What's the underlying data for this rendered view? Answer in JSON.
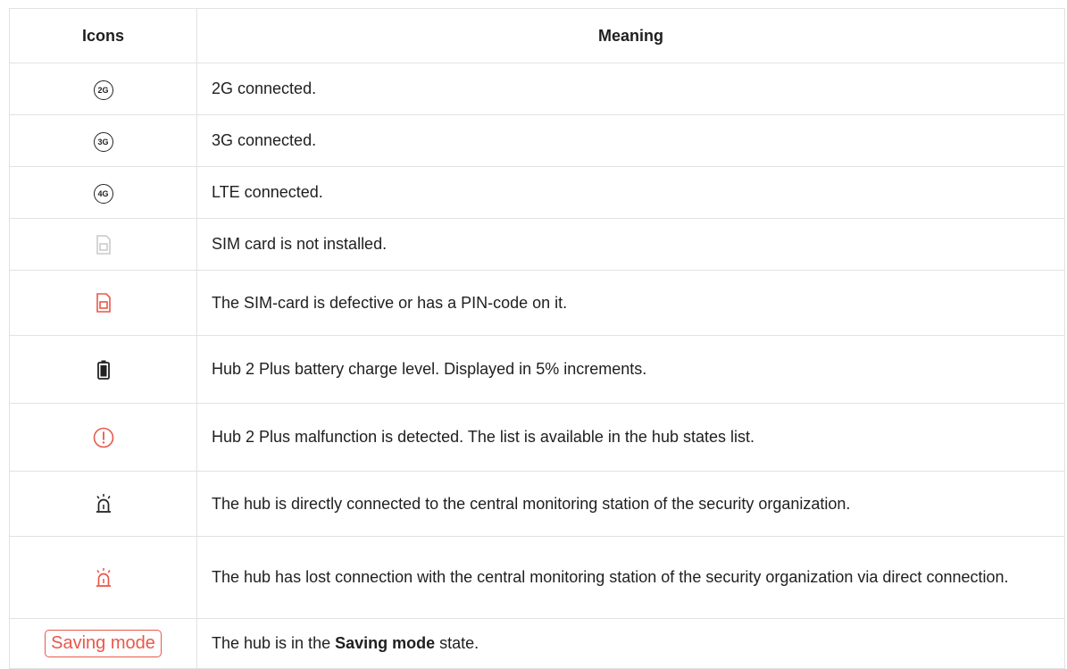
{
  "table": {
    "headers": {
      "icons": "Icons",
      "meaning": "Meaning"
    },
    "rows": [
      {
        "icon": "2g-icon",
        "icon_text": "2G",
        "meaning": "2G connected."
      },
      {
        "icon": "3g-icon",
        "icon_text": "3G",
        "meaning": "3G connected."
      },
      {
        "icon": "4g-icon",
        "icon_text": "4G",
        "meaning": "LTE connected."
      },
      {
        "icon": "sim-missing-icon",
        "meaning": "SIM card is not installed."
      },
      {
        "icon": "sim-error-icon",
        "meaning": "The SIM-card is defective or has a PIN-code on it."
      },
      {
        "icon": "battery-icon",
        "meaning": "Hub 2 Plus battery charge level. Displayed in 5% increments."
      },
      {
        "icon": "malfunction-icon",
        "meaning": "Hub 2 Plus malfunction is detected. The list is available in the hub states list."
      },
      {
        "icon": "siren-connected-icon",
        "meaning": "The hub is directly connected to the central monitoring station of the security organization."
      },
      {
        "icon": "siren-lost-icon",
        "meaning": "The hub has lost connection with the central monitoring station of the security organization via direct connection."
      },
      {
        "icon": "saving-mode-badge",
        "badge_text": "Saving mode",
        "meaning_before": "The hub is in the ",
        "meaning_bold": "Saving mode",
        "meaning_after": " state."
      }
    ]
  },
  "colors": {
    "icon_dark": "#222222",
    "icon_light": "#c8c8c8",
    "alert_red": "#e8584a",
    "border": "#e2e2e2"
  }
}
